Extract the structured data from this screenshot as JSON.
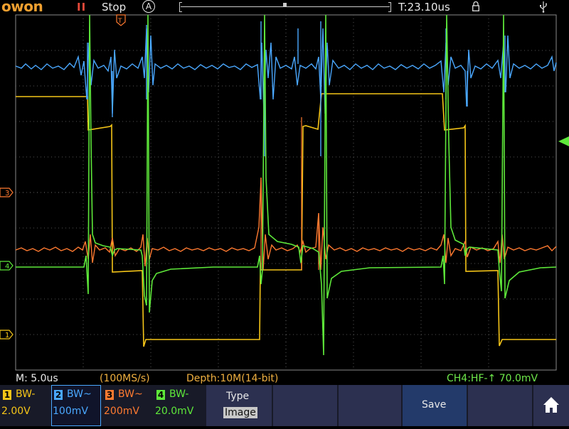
{
  "header": {
    "logo": "owon",
    "run_icon": "II",
    "run_state": "Stop",
    "trigger_mode": "A",
    "trigger_position": "T:23.10us"
  },
  "status": {
    "timebase": "M: 5.0us",
    "sample_rate": "(100MS/s)",
    "depth": "Depth:10M(14-bit)",
    "trigger": "CH4:HF-↑ 70.0mV"
  },
  "channels": [
    {
      "num": "1",
      "bw": "BW-",
      "scale": "2.00V",
      "color": "#f5c518"
    },
    {
      "num": "2",
      "bw": "BW~",
      "scale": "100mV",
      "color": "#4aa8ff"
    },
    {
      "num": "3",
      "bw": "BW~",
      "scale": "200mV",
      "color": "#ff7a30"
    },
    {
      "num": "4",
      "bw": "BW-",
      "scale": "20.0mV",
      "color": "#5ee83a"
    }
  ],
  "markers": {
    "ch3": "3",
    "ch4": "4",
    "ch1": "1",
    "trigger_top": "T"
  },
  "menu": {
    "type_label": "Type",
    "type_value": "Image",
    "save_label": "Save"
  },
  "icons": [
    "lock-icon",
    "usb-icon",
    "home-icon"
  ]
}
